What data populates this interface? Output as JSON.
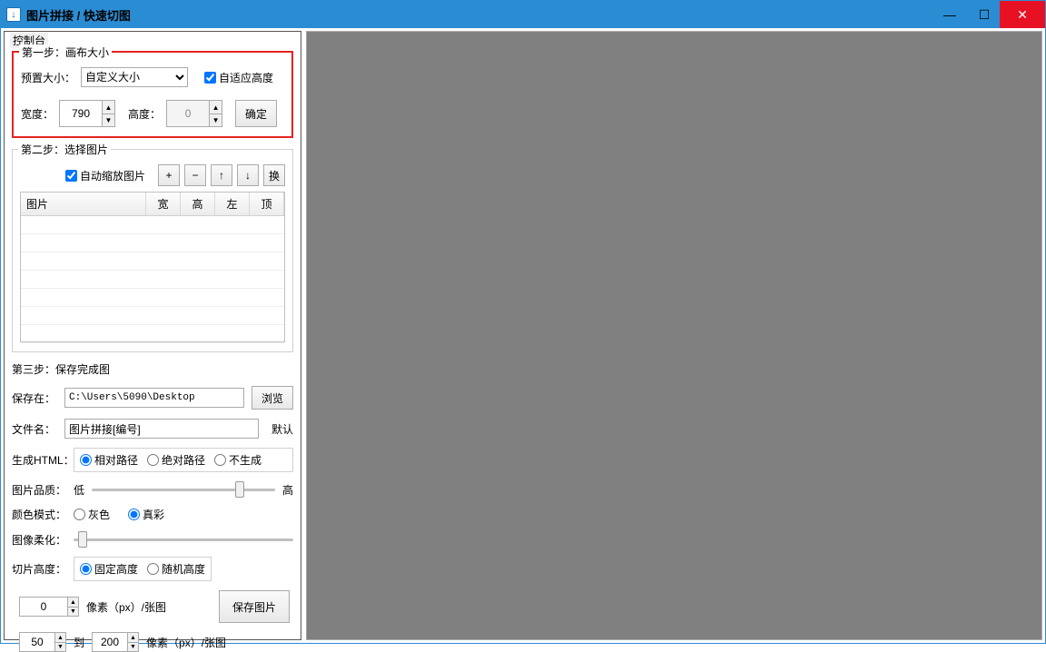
{
  "window": {
    "title": "图片拼接 / 快速切图"
  },
  "sidebar": {
    "label": "控制台"
  },
  "step1": {
    "title": "第一步：画布大小",
    "preset_label": "预置大小：",
    "preset_value": "自定义大小",
    "adaptive_label": "自适应高度",
    "width_label": "宽度：",
    "width_value": "790",
    "height_label": "高度：",
    "height_value": "0",
    "confirm": "确定"
  },
  "step2": {
    "title": "第二步：选择图片",
    "autoscale_label": "自动缩放图片",
    "btn_add": "+",
    "btn_remove": "−",
    "btn_up": "↑",
    "btn_down": "↓",
    "btn_swap": "换",
    "cols": [
      "图片",
      "宽",
      "高",
      "左",
      "顶"
    ]
  },
  "step3": {
    "title": "第三步：保存完成图",
    "save_to_label": "保存在：",
    "save_to_value": "C:\\Users\\5090\\Desktop",
    "browse": "浏览",
    "filename_label": "文件名：",
    "filename_value": "图片拼接[编号]",
    "default": "默认",
    "html_label": "生成HTML：",
    "html_opts": [
      "相对路径",
      "绝对路径",
      "不生成"
    ],
    "quality_label": "图片品质：",
    "quality_low": "低",
    "quality_high": "高",
    "colormode_label": "颜色模式：",
    "colormode_opts": [
      "灰色",
      "真彩"
    ],
    "soften_label": "图像柔化：",
    "slice_label": "切片高度：",
    "slice_opts": [
      "固定高度",
      "随机高度"
    ],
    "fixed_value": "0",
    "unit_fixed": "像素（px）/张图",
    "save_btn": "保存图片",
    "rand_from": "50",
    "rand_to_label": "到",
    "rand_to": "200",
    "unit_rand": "像素（px）/张图"
  }
}
